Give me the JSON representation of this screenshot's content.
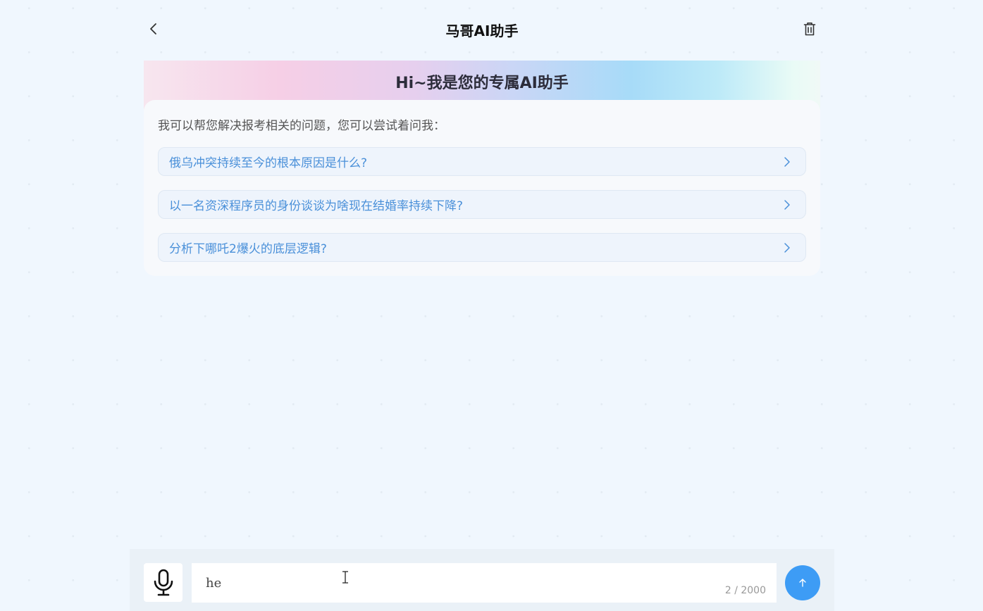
{
  "header": {
    "title": "马哥AI助手",
    "back_icon": "chevron-left-icon",
    "delete_icon": "trash-icon"
  },
  "welcome": {
    "banner_title": "Hi~我是您的专属AI助手",
    "intro": "我可以帮您解决报考相关的问题，您可以尝试着问我：",
    "suggestions": [
      {
        "label": "俄乌冲突持续至今的根本原因是什么?"
      },
      {
        "label": "以一名资深程序员的身份谈谈为啥现在结婚率持续下降?"
      },
      {
        "label": "分析下哪吒2爆火的底层逻辑?"
      }
    ]
  },
  "input": {
    "value": "he",
    "counter": "2 / 2000",
    "mic_icon": "microphone-icon",
    "send_icon": "arrow-up-icon"
  },
  "colors": {
    "background": "#f0f7fe",
    "accent": "#3d9cf5",
    "suggestion_text": "#4a90d9"
  }
}
